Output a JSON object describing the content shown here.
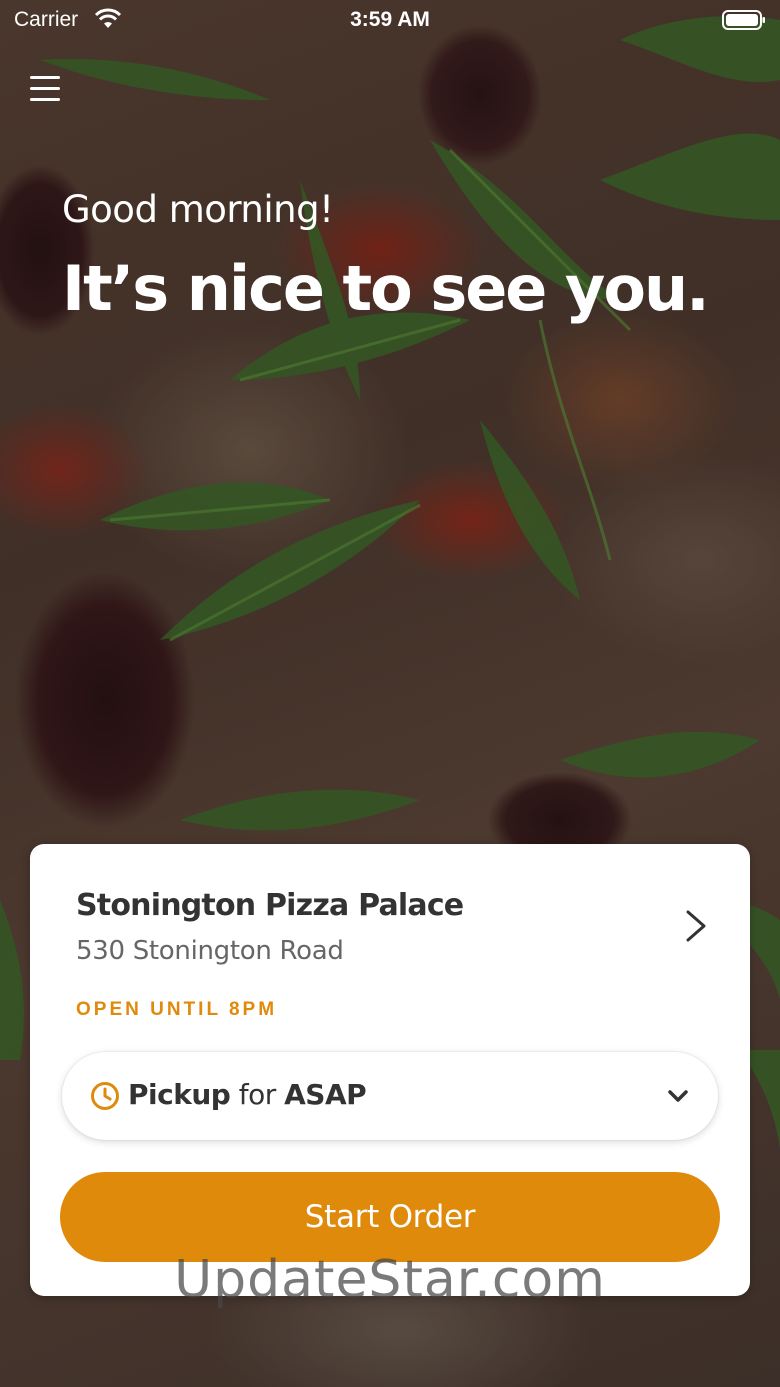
{
  "status_bar": {
    "carrier": "Carrier",
    "time": "3:59 AM",
    "icons": [
      "wifi-icon",
      "battery-icon"
    ]
  },
  "header": {
    "menu_icon": "hamburger-menu-icon",
    "greeting": "Good morning!",
    "headline": "It’s nice to see you."
  },
  "store_card": {
    "name": "Stonington Pizza Palace",
    "address": "530 Stonington Road",
    "hours": "OPEN UNTIL 8PM",
    "order_type": "Pickup",
    "connector": "for",
    "time_option": "ASAP",
    "start_button_label": "Start Order"
  },
  "watermark": "UpdateStar.com",
  "colors": {
    "accent": "#e08a0b",
    "card_background": "#ffffff",
    "text_primary": "#333333",
    "text_secondary": "#666666"
  }
}
